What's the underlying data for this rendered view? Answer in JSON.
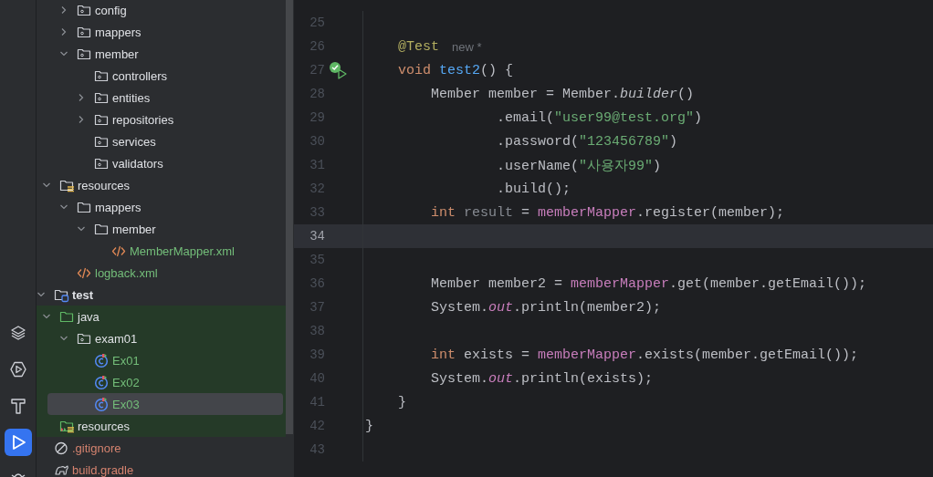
{
  "tool_strip": [
    {
      "kind": "layers",
      "selected": false
    },
    {
      "kind": "services",
      "selected": false
    },
    {
      "kind": "build",
      "selected": false
    },
    {
      "kind": "run",
      "selected": true
    },
    {
      "kind": "debug",
      "selected": false
    }
  ],
  "project_tree": [
    {
      "children": [
        {
          "children": [
            {
              "children": [
                {
                  "label": "config",
                  "kind": "package",
                  "expanded": false,
                  "in_test_sources": false,
                  "selected": false
                },
                {
                  "label": "mappers",
                  "kind": "package",
                  "expanded": false,
                  "in_test_sources": false,
                  "selected": false
                },
                {
                  "label": "member",
                  "kind": "package",
                  "expanded": true,
                  "in_test_sources": false,
                  "selected": false,
                  "children": [
                    {
                      "label": "controllers",
                      "kind": "package",
                      "in_test_sources": false,
                      "selected": false
                    },
                    {
                      "label": "entities",
                      "kind": "package",
                      "expanded": false,
                      "in_test_sources": false,
                      "selected": false
                    },
                    {
                      "label": "repositories",
                      "kind": "package",
                      "expanded": false,
                      "in_test_sources": false,
                      "selected": false
                    },
                    {
                      "label": "services",
                      "kind": "package",
                      "in_test_sources": false,
                      "selected": false
                    },
                    {
                      "label": "validators",
                      "kind": "package",
                      "in_test_sources": false,
                      "selected": false
                    }
                  ]
                }
              ]
            },
            {
              "label": "resources",
              "kind": "resources",
              "expanded": true,
              "in_test_sources": false,
              "selected": false,
              "children": [
                {
                  "label": "mappers",
                  "kind": "folder",
                  "expanded": true,
                  "in_test_sources": false,
                  "selected": false,
                  "children": [
                    {
                      "label": "member",
                      "kind": "folder",
                      "expanded": true,
                      "in_test_sources": false,
                      "selected": false,
                      "children": [
                        {
                          "label": "MemberMapper.xml",
                          "kind": "xml",
                          "color": "#73bd79",
                          "in_test_sources": false,
                          "selected": false
                        }
                      ]
                    }
                  ]
                },
                {
                  "label": "logback.xml",
                  "kind": "xml",
                  "color": "#73bd79",
                  "in_test_sources": false,
                  "selected": false
                }
              ]
            }
          ]
        },
        {
          "label": "test",
          "kind": "test_root",
          "bold": true,
          "expanded": true,
          "in_test_sources": false,
          "selected": false,
          "children": [
            {
              "label": "java",
              "kind": "test_sources",
              "expanded": true,
              "in_test_sources": true,
              "selected": false,
              "children": [
                {
                  "label": "exam01",
                  "kind": "package",
                  "expanded": true,
                  "in_test_sources": true,
                  "selected": false,
                  "children": [
                    {
                      "label": "Ex01",
                      "kind": "test_class",
                      "color": "#73bd79",
                      "in_test_sources": true,
                      "selected": false
                    },
                    {
                      "label": "Ex02",
                      "kind": "test_class",
                      "color": "#73bd79",
                      "in_test_sources": true,
                      "selected": false
                    },
                    {
                      "label": "Ex03",
                      "kind": "test_class",
                      "color": "#73bd79",
                      "in_test_sources": true,
                      "selected": true
                    }
                  ]
                }
              ]
            },
            {
              "label": "resources",
              "kind": "test_resources",
              "in_test_sources": true,
              "selected": false
            }
          ]
        }
      ]
    },
    {
      "label": ".gitignore",
      "kind": "ignore",
      "color": "#d5836f",
      "in_test_sources": false,
      "selected": false
    },
    {
      "label": "build.gradle",
      "kind": "gradle",
      "color": "#d5836f",
      "in_test_sources": false,
      "selected": false
    }
  ],
  "editor_lines": [
    {
      "number": "25",
      "current": false
    },
    {
      "number": "26",
      "current": false,
      "tokens": [
        {
          "kind": "annotation",
          "text": "    @Test"
        },
        {
          "kind": "hint",
          "text": "new *"
        }
      ]
    },
    {
      "number": "27",
      "current": false,
      "gutter_icon": {
        "kind": "test_passed"
      },
      "tokens": [
        {
          "kind": "keyword",
          "text": "    void "
        },
        {
          "kind": "declaration",
          "text": "test2"
        },
        {
          "kind": "plain",
          "text": "() {"
        }
      ]
    },
    {
      "number": "28",
      "current": false,
      "tokens": [
        {
          "kind": "plain",
          "text": "        Member member = Member."
        },
        {
          "kind": "static_call",
          "text": "builder"
        },
        {
          "kind": "plain",
          "text": "()"
        }
      ]
    },
    {
      "number": "29",
      "current": false,
      "tokens": [
        {
          "kind": "plain",
          "text": "                .email("
        },
        {
          "kind": "string",
          "text": "\"user99@test.org\""
        },
        {
          "kind": "plain",
          "text": ")"
        }
      ]
    },
    {
      "number": "30",
      "current": false,
      "tokens": [
        {
          "kind": "plain",
          "text": "                .password("
        },
        {
          "kind": "string",
          "text": "\"123456789\""
        },
        {
          "kind": "plain",
          "text": ")"
        }
      ]
    },
    {
      "number": "31",
      "current": false,
      "tokens": [
        {
          "kind": "plain",
          "text": "                .userName("
        },
        {
          "kind": "string",
          "text": "\"사용자99\""
        },
        {
          "kind": "plain",
          "text": ")"
        }
      ]
    },
    {
      "number": "32",
      "current": false,
      "tokens": [
        {
          "kind": "plain",
          "text": "                .build();"
        }
      ]
    },
    {
      "number": "33",
      "current": false,
      "tokens": [
        {
          "kind": "keyword",
          "text": "        int "
        },
        {
          "kind": "unused",
          "text": "result"
        },
        {
          "kind": "plain",
          "text": " = "
        },
        {
          "kind": "field",
          "text": "memberMapper"
        },
        {
          "kind": "plain",
          "text": ".register(member);"
        }
      ]
    },
    {
      "number": "34",
      "current": true
    },
    {
      "number": "35",
      "current": false
    },
    {
      "number": "36",
      "current": false,
      "tokens": [
        {
          "kind": "plain",
          "text": "        Member member2 = "
        },
        {
          "kind": "field",
          "text": "memberMapper"
        },
        {
          "kind": "plain",
          "text": ".get(member.getEmail());"
        }
      ]
    },
    {
      "number": "37",
      "current": false,
      "tokens": [
        {
          "kind": "plain",
          "text": "        System."
        },
        {
          "kind": "static_field",
          "text": "out"
        },
        {
          "kind": "plain",
          "text": ".println(member2);"
        }
      ]
    },
    {
      "number": "38",
      "current": false
    },
    {
      "number": "39",
      "current": false,
      "tokens": [
        {
          "kind": "keyword",
          "text": "        int "
        },
        {
          "kind": "plain",
          "text": "exists = "
        },
        {
          "kind": "field",
          "text": "memberMapper"
        },
        {
          "kind": "plain",
          "text": ".exists(member.getEmail());"
        }
      ]
    },
    {
      "number": "40",
      "current": false,
      "tokens": [
        {
          "kind": "plain",
          "text": "        System."
        },
        {
          "kind": "static_field",
          "text": "out"
        },
        {
          "kind": "plain",
          "text": ".println(exists);"
        }
      ]
    },
    {
      "number": "41",
      "current": false,
      "tokens": [
        {
          "kind": "plain",
          "text": "    }"
        }
      ]
    },
    {
      "number": "42",
      "current": false,
      "tokens": [
        {
          "kind": "plain",
          "text": "}"
        }
      ]
    },
    {
      "number": "43",
      "current": false
    }
  ]
}
